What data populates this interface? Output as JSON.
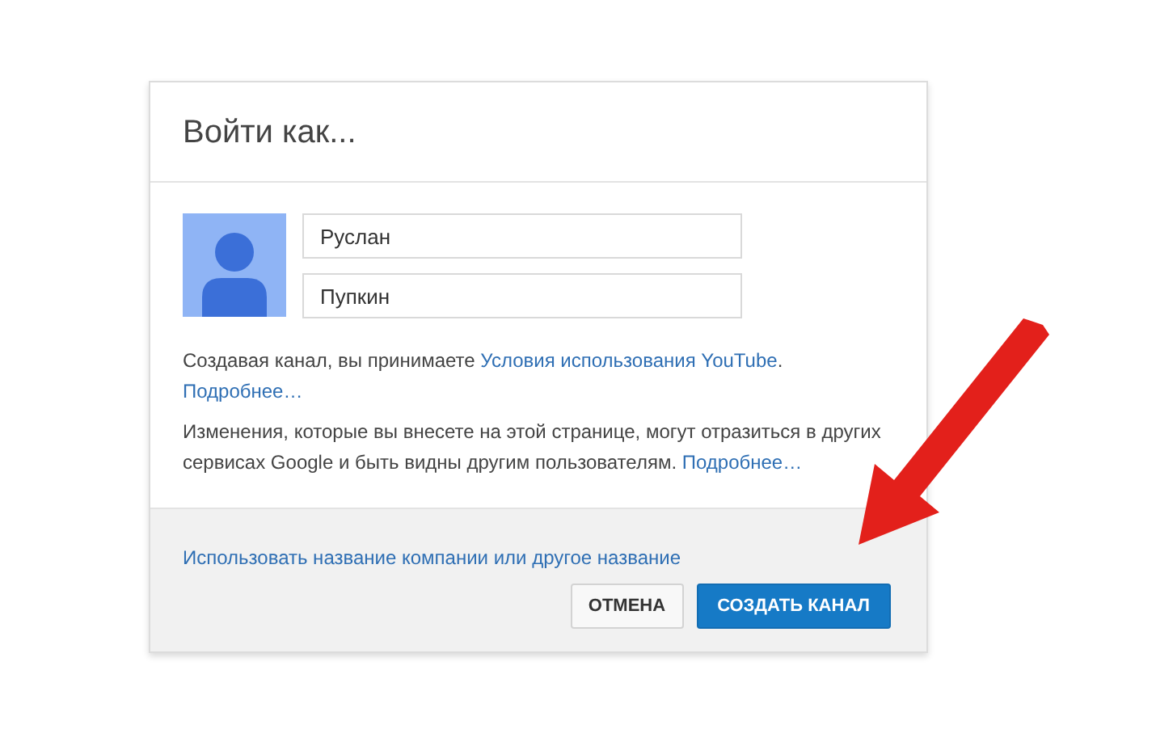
{
  "dialog": {
    "title": "Войти как...",
    "fields": [
      {
        "value": "Руслан"
      },
      {
        "value": "Пупкин"
      }
    ],
    "paragraphs": [
      [
        {
          "kind": "text",
          "text": "Создавая канал, вы принимаете "
        },
        {
          "kind": "link",
          "text": "Условия использования YouTube"
        },
        {
          "kind": "text",
          "text": "."
        },
        {
          "kind": "link",
          "text": "Подробнее…"
        }
      ],
      [
        {
          "kind": "text",
          "text": "Изменения, которые вы внесете на этой странице, могут отразиться в других сервисах Google и быть видны другим пользователям. "
        },
        {
          "kind": "link",
          "text": "Подробнее…"
        }
      ]
    ],
    "footer_link": "Использовать название компании или другое название",
    "buttons": [
      {
        "label": "ОТМЕНА",
        "kind": "secondary"
      },
      {
        "label": "СОЗДАТЬ КАНАЛ",
        "kind": "primary"
      }
    ]
  }
}
